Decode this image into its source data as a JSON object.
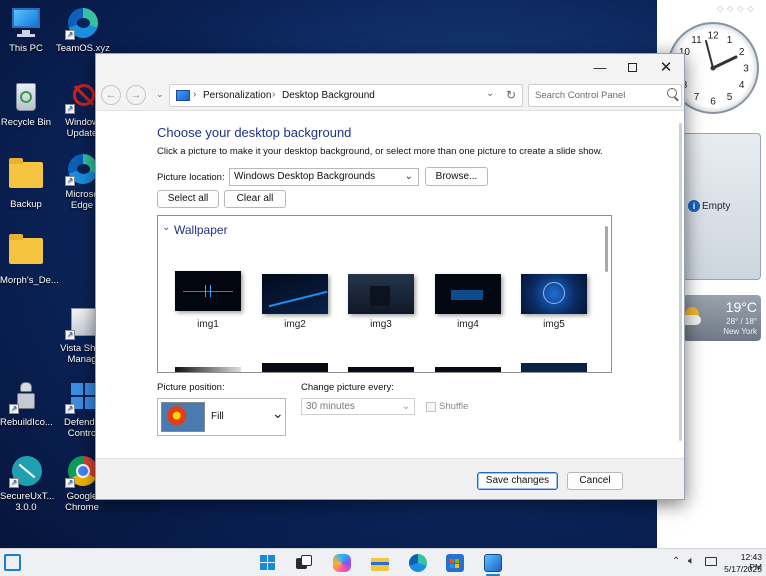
{
  "desktop": {
    "icons": [
      {
        "label": "This PC"
      },
      {
        "label": "TeamOS.xyz"
      },
      {
        "label": "Recycle Bin"
      },
      {
        "label": "Window Update"
      },
      {
        "label": "Backup"
      },
      {
        "label": "Microso Edge"
      },
      {
        "label": "Morph's_De..."
      },
      {
        "label": "Vista Shor Manag"
      },
      {
        "label": "RebuildIco..."
      },
      {
        "label": "Defende Contro"
      },
      {
        "label": "SecureUxT... 3.0.0"
      },
      {
        "label": "Google Chrome"
      }
    ]
  },
  "gadgets": {
    "clock": {
      "numbers": [
        "12",
        "1",
        "2",
        "3",
        "4",
        "5",
        "6",
        "7",
        "8",
        "9",
        "10",
        "11"
      ],
      "time": "12:43"
    },
    "slideshow": {
      "label": "Empty"
    },
    "weather": {
      "temp": "19°C",
      "range": "28° / 18°",
      "city": "New York"
    }
  },
  "window": {
    "breadcrumb": [
      "Personalization",
      "Desktop Background"
    ],
    "search_placeholder": "Search Control Panel",
    "heading": "Choose your desktop background",
    "subtitle": "Click a picture to make it your desktop background, or select more than one picture to create a slide show.",
    "picture_location_label": "Picture location:",
    "picture_location_value": "Windows Desktop Backgrounds",
    "browse_label": "Browse...",
    "select_all_label": "Select all",
    "clear_all_label": "Clear all",
    "group_label": "Wallpaper",
    "images": [
      {
        "label": "img1"
      },
      {
        "label": "img2"
      },
      {
        "label": "img3"
      },
      {
        "label": "img4"
      },
      {
        "label": "img5"
      }
    ],
    "picture_position_label": "Picture position:",
    "picture_position_value": "Fill",
    "change_every_label": "Change picture every:",
    "change_every_value": "30 minutes",
    "shuffle_label": "Shuffle",
    "save_label": "Save changes",
    "cancel_label": "Cancel"
  },
  "taskbar": {
    "time": "12:43 PM",
    "date": "5/17/2025"
  }
}
